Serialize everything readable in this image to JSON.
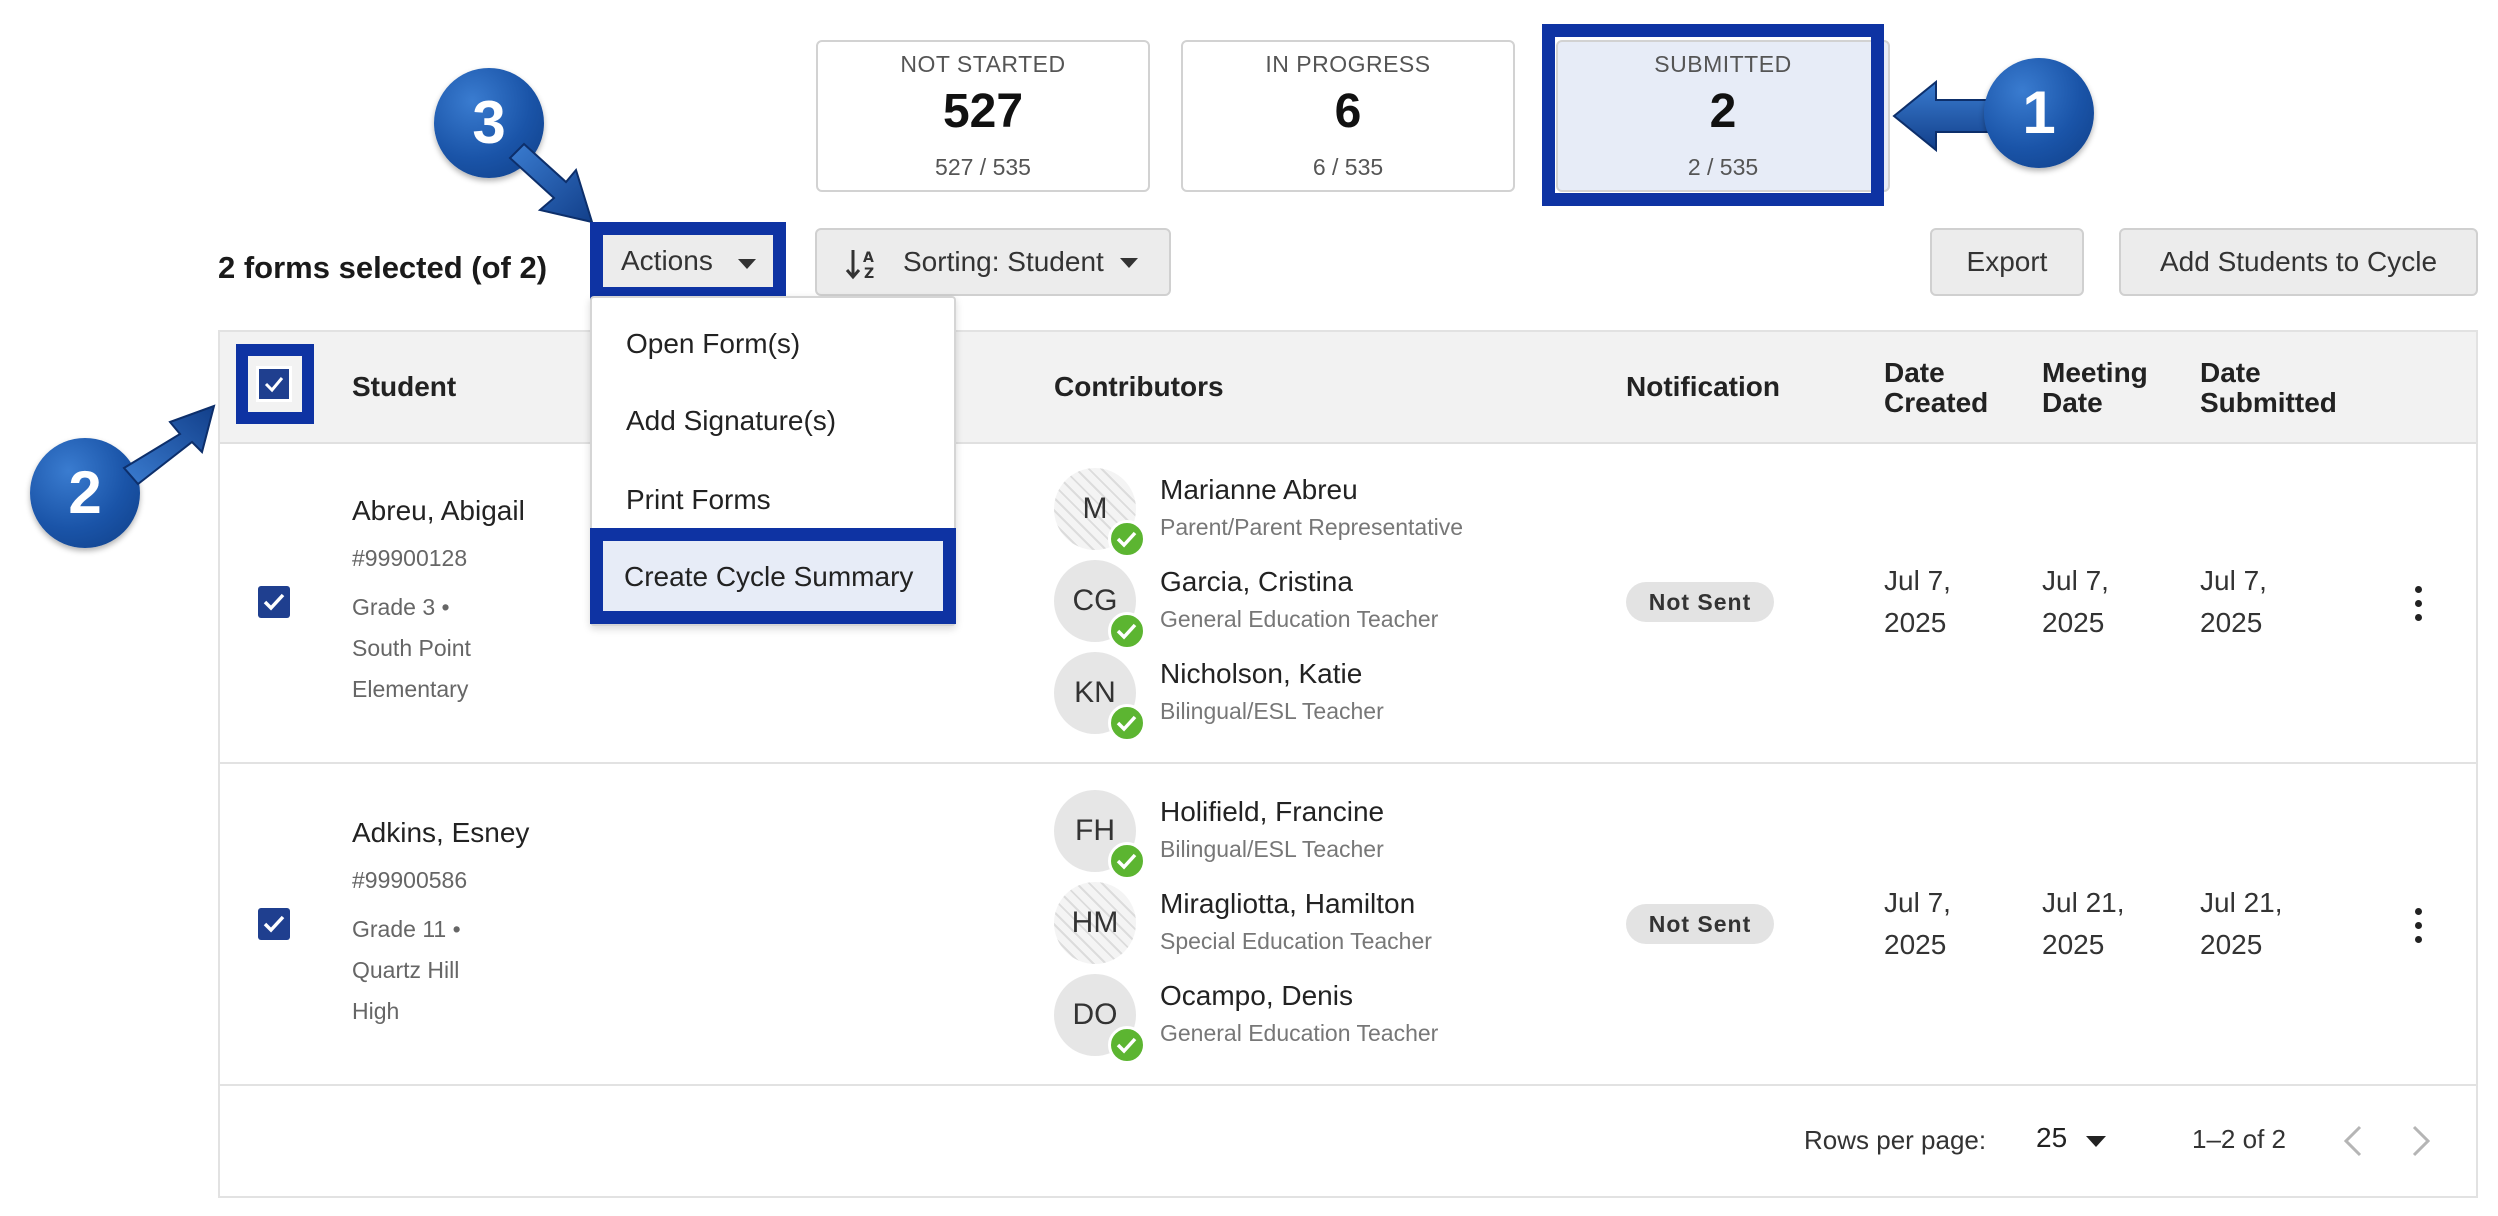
{
  "stats": [
    {
      "label": "NOT STARTED",
      "count": "527",
      "fraction": "527 / 535",
      "selected": false
    },
    {
      "label": "IN PROGRESS",
      "count": "6",
      "fraction": "6 / 535",
      "selected": false
    },
    {
      "label": "SUBMITTED",
      "count": "2",
      "fraction": "2 / 535",
      "selected": true
    }
  ],
  "callouts": [
    "1",
    "2",
    "3"
  ],
  "toolbar": {
    "selection_text": "2 forms selected (of 2)",
    "actions_label": "Actions",
    "sorting_label": "Sorting: Student",
    "export_label": "Export",
    "add_students_label": "Add Students to Cycle"
  },
  "actions_menu": {
    "items": [
      "Open Form(s)",
      "Add Signature(s)",
      "Print Forms",
      "Create Cycle Summary"
    ],
    "highlighted": "Create Cycle Summary"
  },
  "table": {
    "headers": {
      "student": "Student",
      "contributors": "Contributors",
      "notification": "Notification",
      "date_created": [
        "Date",
        "Created"
      ],
      "meeting_date": [
        "Meeting",
        "Date"
      ],
      "date_submitted": [
        "Date",
        "Submitted"
      ]
    },
    "rows": [
      {
        "checked": true,
        "name": "Abreu, Abigail",
        "id": "#99900128",
        "grade": "Grade 3 •",
        "school": [
          "South Point",
          "Elementary"
        ],
        "contributors": [
          {
            "initials": "M",
            "name": "Marianne Abreu",
            "role": "Parent/Parent Representative",
            "hatched": true
          },
          {
            "initials": "CG",
            "name": "Garcia, Cristina",
            "role": "General Education Teacher",
            "hatched": false
          },
          {
            "initials": "KN",
            "name": "Nicholson, Katie",
            "role": "Bilingual/ESL Teacher",
            "hatched": false
          }
        ],
        "notification": "Not Sent",
        "date_created": [
          "Jul 7,",
          "2025"
        ],
        "meeting_date": [
          "Jul 7,",
          "2025"
        ],
        "date_submitted": [
          "Jul 7,",
          "2025"
        ]
      },
      {
        "checked": true,
        "name": "Adkins, Esney",
        "id": "#99900586",
        "grade": "Grade 11 •",
        "school": [
          "Quartz Hill",
          "High"
        ],
        "contributors": [
          {
            "initials": "FH",
            "name": "Holifield, Francine",
            "role": "Bilingual/ESL Teacher",
            "hatched": false
          },
          {
            "initials": "HM",
            "name": "Miragliotta, Hamilton",
            "role": "Special Education Teacher",
            "hatched": true
          },
          {
            "initials": "DO",
            "name": "Ocampo, Denis",
            "role": "General Education Teacher",
            "hatched": false
          }
        ],
        "notification": "Not Sent",
        "date_created": [
          "Jul 7,",
          "2025"
        ],
        "meeting_date": [
          "Jul 21,",
          "2025"
        ],
        "date_submitted": [
          "Jul 21,",
          "2025"
        ]
      }
    ]
  },
  "pagination": {
    "rows_per_page_label": "Rows per page:",
    "rows_per_page_value": "25",
    "range": "1–2 of 2"
  },
  "colors": {
    "highlight": "#0e33a3",
    "callout": "#1a54a8",
    "checkbox": "#1f3f8f",
    "check_badge": "#5cb531"
  },
  "icons": [
    "arrow-left-icon",
    "arrow-up-right-icon",
    "arrow-down-right-icon",
    "sort-icon",
    "caret-down-icon",
    "check-icon",
    "kebab-icon",
    "chevron-left-icon",
    "chevron-right-icon"
  ]
}
